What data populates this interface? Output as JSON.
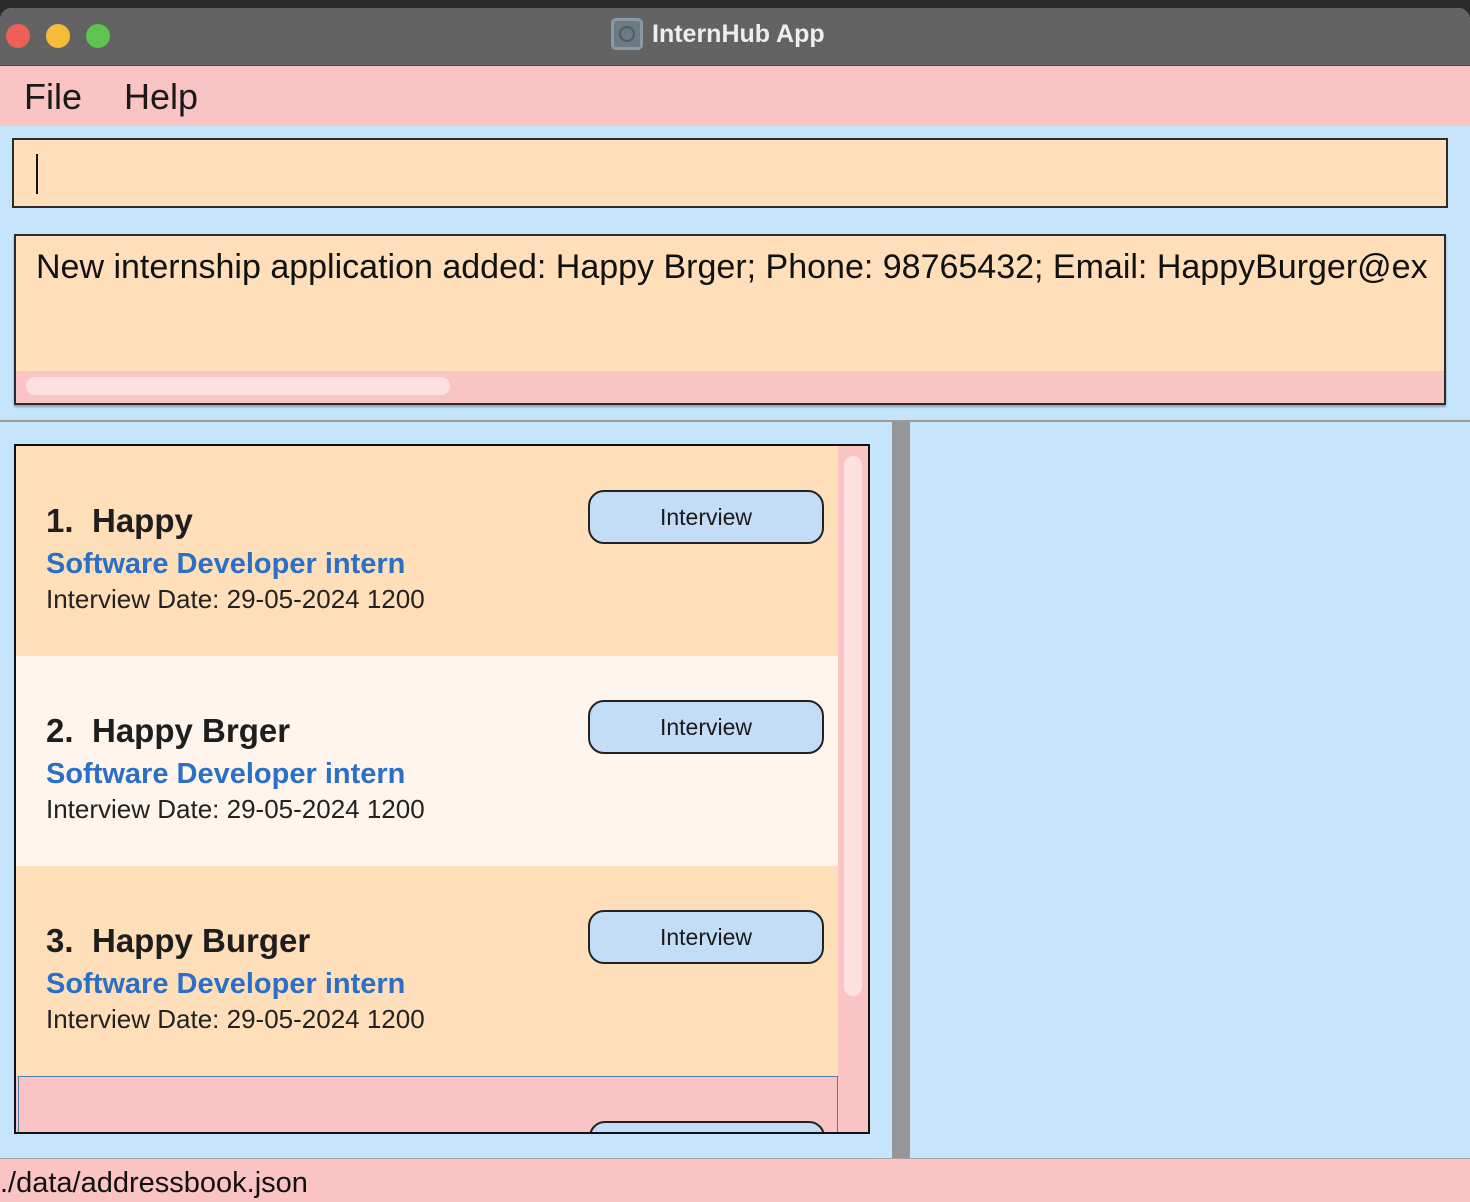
{
  "window": {
    "title": "InternHub App"
  },
  "menu": {
    "file": "File",
    "help": "Help"
  },
  "command": {
    "value": ""
  },
  "result": {
    "text": "New internship application added: Happy Brger; Phone: 98765432; Email: HappyBurger@ex"
  },
  "applications": [
    {
      "index": "1.",
      "company": "Happy",
      "role": "Software Developer intern",
      "interview_date": "Interview Date: 29-05-2024 1200",
      "status": "Interview"
    },
    {
      "index": "2.",
      "company": "Happy Brger",
      "role": "Software Developer intern",
      "interview_date": "Interview Date: 29-05-2024 1200",
      "status": "Interview"
    },
    {
      "index": "3.",
      "company": "Happy Burger",
      "role": "Software Developer intern",
      "interview_date": "Interview Date: 29-05-2024 1200",
      "status": "Interview"
    }
  ],
  "status_bar": {
    "path": "./data/addressbook.json"
  },
  "colors": {
    "menu_bg": "#fac4c4",
    "panel_bg": "#c6e5fd",
    "card_bg": "#ffdfba",
    "card_alt_bg": "#fff5ec",
    "role_text": "#2a70c8",
    "status_button": "#c3ddf6"
  }
}
